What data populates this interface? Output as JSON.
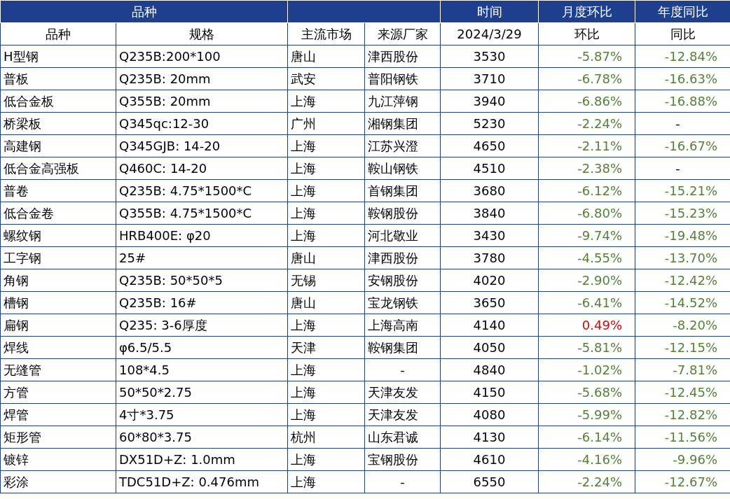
{
  "top_header": [
    "品种",
    "时间",
    "月度环比",
    "年度同比"
  ],
  "columns": [
    "品种",
    "规格",
    "主流市场",
    "来源厂家",
    "2024/3/29",
    "环比",
    "同比"
  ],
  "rows": [
    {
      "variety": "H型钢",
      "spec": "Q235B:200*100",
      "market": "唐山",
      "source": "津西股份",
      "price": "3530",
      "mom": {
        "text": "-5.87%",
        "color": "#548235"
      },
      "yoy": {
        "text": "-12.84%",
        "color": "#548235"
      }
    },
    {
      "variety": "普板",
      "spec": "Q235B: 20mm",
      "market": "武安",
      "source": "普阳钢铁",
      "price": "3710",
      "mom": {
        "text": "-6.78%",
        "color": "#548235"
      },
      "yoy": {
        "text": "-16.63%",
        "color": "#548235"
      }
    },
    {
      "variety": "低合金板",
      "spec": "Q355B: 20mm",
      "market": "上海",
      "source": "九江萍钢",
      "price": "3940",
      "mom": {
        "text": "-6.86%",
        "color": "#548235"
      },
      "yoy": {
        "text": "-16.88%",
        "color": "#548235"
      }
    },
    {
      "variety": "桥梁板",
      "spec": "Q345qc:12-30",
      "market": "广州",
      "source": "湘钢集团",
      "price": "5230",
      "mom": {
        "text": "-2.24%",
        "color": "#548235"
      },
      "yoy": {
        "text": "-",
        "color": "#000000"
      }
    },
    {
      "variety": "高建钢",
      "spec": "Q345GJB: 14-20",
      "market": "上海",
      "source": "江苏兴澄",
      "price": "4650",
      "mom": {
        "text": "-2.11%",
        "color": "#548235"
      },
      "yoy": {
        "text": "-16.67%",
        "color": "#548235"
      }
    },
    {
      "variety": "低合金高强板",
      "spec": "Q460C: 14-20",
      "market": "上海",
      "source": "鞍山钢铁",
      "price": "4510",
      "mom": {
        "text": "-2.38%",
        "color": "#548235"
      },
      "yoy": {
        "text": "-",
        "color": "#000000"
      }
    },
    {
      "variety": "普卷",
      "spec": "Q235B: 4.75*1500*C",
      "market": "上海",
      "source": "首钢集团",
      "price": "3680",
      "mom": {
        "text": "-6.12%",
        "color": "#548235"
      },
      "yoy": {
        "text": "-15.21%",
        "color": "#548235"
      }
    },
    {
      "variety": "低合金卷",
      "spec": "Q355B: 4.75*1500*C",
      "market": "上海",
      "source": "鞍钢股份",
      "price": "3840",
      "mom": {
        "text": "-6.80%",
        "color": "#548235"
      },
      "yoy": {
        "text": "-15.23%",
        "color": "#548235"
      }
    },
    {
      "variety": "螺纹钢",
      "spec": "HRB400E: φ20",
      "market": "上海",
      "source": "河北敬业",
      "price": "3430",
      "mom": {
        "text": "-9.74%",
        "color": "#548235"
      },
      "yoy": {
        "text": "-19.48%",
        "color": "#548235"
      }
    },
    {
      "variety": "工字钢",
      "spec": "25#",
      "market": "唐山",
      "source": "津西股份",
      "price": "3780",
      "mom": {
        "text": "-4.55%",
        "color": "#548235"
      },
      "yoy": {
        "text": "-13.70%",
        "color": "#548235"
      }
    },
    {
      "variety": "角钢",
      "spec": "Q235B: 50*50*5",
      "market": "无锡",
      "source": "安钢股份",
      "price": "4020",
      "mom": {
        "text": "-2.90%",
        "color": "#548235"
      },
      "yoy": {
        "text": "-12.42%",
        "color": "#548235"
      }
    },
    {
      "variety": "槽钢",
      "spec": "Q235B: 16#",
      "market": "唐山",
      "source": "宝龙钢铁",
      "price": "3650",
      "mom": {
        "text": "-6.41%",
        "color": "#548235"
      },
      "yoy": {
        "text": "-14.52%",
        "color": "#548235"
      }
    },
    {
      "variety": "扁钢",
      "spec": "Q235: 3-6厚度",
      "market": "上海",
      "source": "上海高南",
      "price": "4140",
      "mom": {
        "text": "0.49%",
        "color": "#e00000"
      },
      "yoy": {
        "text": "-8.20%",
        "color": "#548235"
      }
    },
    {
      "variety": "焊线",
      "spec": "φ6.5/5.5",
      "market": "天津",
      "source": "鞍钢集团",
      "price": "4050",
      "mom": {
        "text": "-5.81%",
        "color": "#548235"
      },
      "yoy": {
        "text": "-12.15%",
        "color": "#548235"
      }
    },
    {
      "variety": "无缝管",
      "spec": "108*4.5",
      "market": "上海",
      "source": "-",
      "price": "4840",
      "mom": {
        "text": "-1.02%",
        "color": "#548235"
      },
      "yoy": {
        "text": "-7.81%",
        "color": "#548235"
      }
    },
    {
      "variety": "方管",
      "spec": "50*50*2.75",
      "market": "上海",
      "source": "天津友发",
      "price": "4150",
      "mom": {
        "text": "-5.68%",
        "color": "#548235"
      },
      "yoy": {
        "text": "-12.45%",
        "color": "#548235"
      }
    },
    {
      "variety": "焊管",
      "spec": "4寸*3.75",
      "market": "上海",
      "source": "天津友发",
      "price": "4080",
      "mom": {
        "text": "-5.99%",
        "color": "#548235"
      },
      "yoy": {
        "text": "-12.82%",
        "color": "#548235"
      }
    },
    {
      "variety": "矩形管",
      "spec": "60*80*3.75",
      "market": "杭州",
      "source": "山东君诚",
      "price": "4130",
      "mom": {
        "text": "-6.14%",
        "color": "#548235"
      },
      "yoy": {
        "text": "-11.56%",
        "color": "#548235"
      }
    },
    {
      "variety": "镀锌",
      "spec": "DX51D+Z: 1.0mm",
      "market": "上海",
      "source": "宝钢股份",
      "price": "4610",
      "mom": {
        "text": "-4.16%",
        "color": "#548235"
      },
      "yoy": {
        "text": "-9.96%",
        "color": "#548235"
      }
    },
    {
      "variety": "彩涂",
      "spec": "TDC51D+Z: 0.476mm",
      "market": "上海",
      "source": "-",
      "price": "6550",
      "mom": {
        "text": "-2.24%",
        "color": "#548235"
      },
      "yoy": {
        "text": "-12.67%",
        "color": "#548235"
      }
    }
  ]
}
